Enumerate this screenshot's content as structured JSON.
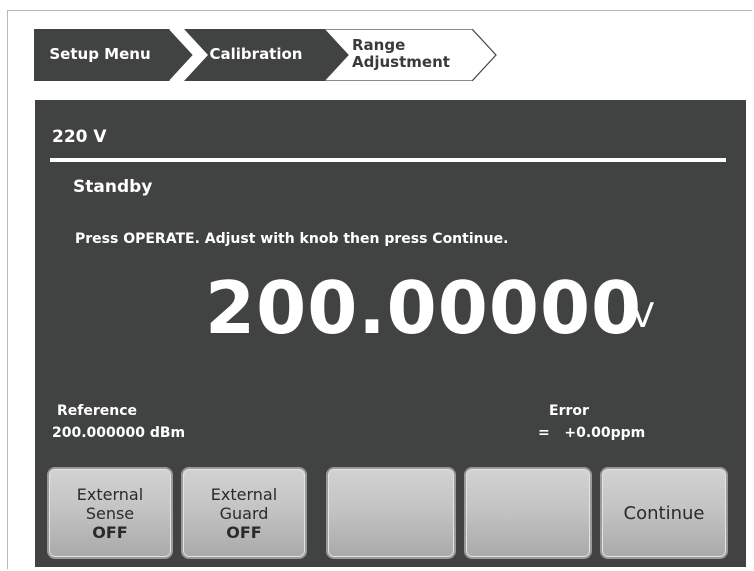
{
  "breadcrumb": {
    "items": [
      {
        "label": "Setup Menu"
      },
      {
        "label": "Calibration"
      },
      {
        "label_line1": "Range",
        "label_line2": "Adjustment"
      }
    ]
  },
  "panel": {
    "range": "220 V",
    "status": "Standby",
    "instruction": "Press OPERATE. Adjust with knob then press Continue.",
    "readout": {
      "value": "200.00000",
      "unit": "V"
    },
    "reference": {
      "label": "Reference",
      "value": "200.000000 dBm"
    },
    "error": {
      "label": "Error",
      "value": "=   +0.00ppm"
    }
  },
  "softkeys": [
    {
      "line1": "External",
      "line2": "Sense",
      "state": "OFF"
    },
    {
      "line1": "External",
      "line2": "Guard",
      "state": "OFF"
    },
    {
      "label": ""
    },
    {
      "label": ""
    },
    {
      "label": "Continue"
    }
  ],
  "colors": {
    "panel_bg": "#414242",
    "crumb_active_bg": "#414242",
    "crumb_inactive_bg": "#ffffff",
    "text_light": "#ffffff",
    "softkey_bg": "#c4c4c4"
  }
}
